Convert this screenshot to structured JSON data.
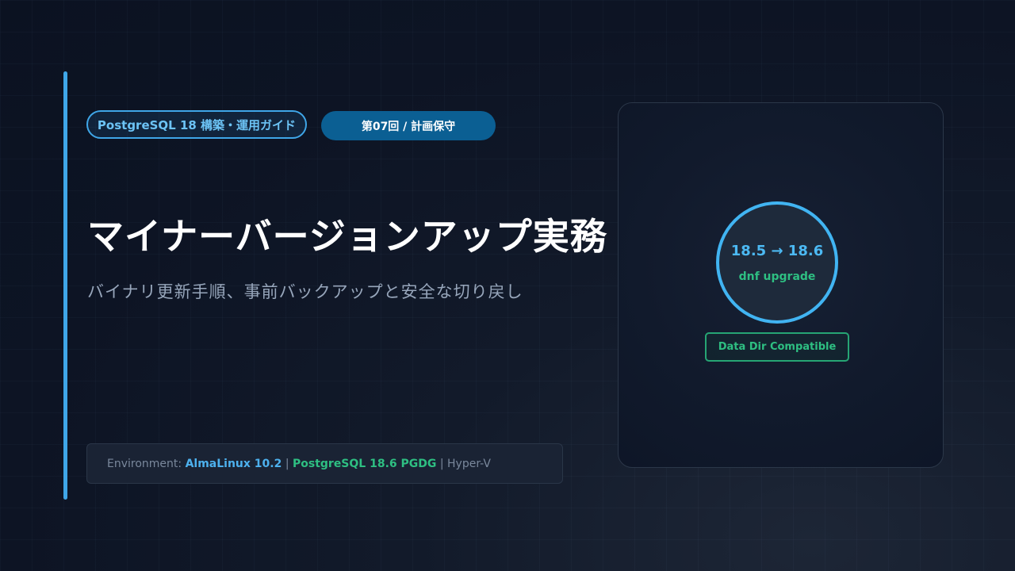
{
  "header": {
    "series_pill": "PostgreSQL 18 構築・運用ガイド",
    "episode_pill": "第07回 / 計画保守"
  },
  "main": {
    "title": "マイナーバージョンアップ実務",
    "subtitle": "バイナリ更新手順、事前バックアップと安全な切り戻し"
  },
  "environment": {
    "label": "Environment:",
    "os": "AlmaLinux 10.2",
    "separator": "|",
    "postgres": "PostgreSQL 18.6 PGDG",
    "hypervisor": "Hyper-V"
  },
  "panel": {
    "version_change": "18.5 → 18.6",
    "command": "dnf upgrade",
    "badge": "Data Dir Compatible"
  },
  "colors": {
    "accent_blue": "#3fa6e8",
    "accent_green": "#2ebf82",
    "background": "#0d1424"
  }
}
